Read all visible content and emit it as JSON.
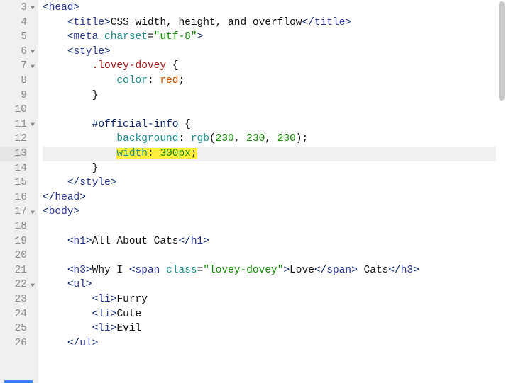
{
  "editor": {
    "first_line": 3,
    "active_line": 13,
    "highlight_line": 13,
    "highlight_text": "width: 300px;",
    "fold_lines": [
      3,
      6,
      7,
      11,
      17,
      22
    ],
    "lines": [
      {
        "n": 3,
        "indent": 0,
        "tokens": [
          {
            "t": "<",
            "c": "tag"
          },
          {
            "t": "head",
            "c": "name"
          },
          {
            "t": ">",
            "c": "tag"
          }
        ]
      },
      {
        "n": 4,
        "indent": 1,
        "tokens": [
          {
            "t": "<",
            "c": "tag"
          },
          {
            "t": "title",
            "c": "name"
          },
          {
            "t": ">",
            "c": "tag"
          },
          {
            "t": "CSS width, height, and overflow",
            "c": "text"
          },
          {
            "t": "</",
            "c": "tag"
          },
          {
            "t": "title",
            "c": "name"
          },
          {
            "t": ">",
            "c": "tag"
          }
        ]
      },
      {
        "n": 5,
        "indent": 1,
        "tokens": [
          {
            "t": "<",
            "c": "tag"
          },
          {
            "t": "meta",
            "c": "name"
          },
          {
            "t": " ",
            "c": "text"
          },
          {
            "t": "charset",
            "c": "attrn"
          },
          {
            "t": "=",
            "c": "punct"
          },
          {
            "t": "\"utf-8\"",
            "c": "val"
          },
          {
            "t": ">",
            "c": "tag"
          }
        ]
      },
      {
        "n": 6,
        "indent": 1,
        "tokens": [
          {
            "t": "<",
            "c": "tag"
          },
          {
            "t": "style",
            "c": "name"
          },
          {
            "t": ">",
            "c": "tag"
          }
        ]
      },
      {
        "n": 7,
        "indent": 2,
        "tokens": [
          {
            "t": ".lovey-dovey",
            "c": "sel"
          },
          {
            "t": " {",
            "c": "punct"
          }
        ]
      },
      {
        "n": 8,
        "indent": 3,
        "tokens": [
          {
            "t": "color",
            "c": "prop"
          },
          {
            "t": ": ",
            "c": "punct"
          },
          {
            "t": "red",
            "c": "kw"
          },
          {
            "t": ";",
            "c": "punct"
          }
        ]
      },
      {
        "n": 9,
        "indent": 2,
        "tokens": [
          {
            "t": "}",
            "c": "punct"
          }
        ]
      },
      {
        "n": 10,
        "indent": 0,
        "tokens": []
      },
      {
        "n": 11,
        "indent": 2,
        "tokens": [
          {
            "t": "#official-info",
            "c": "selid"
          },
          {
            "t": " {",
            "c": "punct"
          }
        ]
      },
      {
        "n": 12,
        "indent": 3,
        "tokens": [
          {
            "t": "background",
            "c": "prop"
          },
          {
            "t": ": ",
            "c": "punct"
          },
          {
            "t": "rgb",
            "c": "func"
          },
          {
            "t": "(",
            "c": "punct"
          },
          {
            "t": "230",
            "c": "num"
          },
          {
            "t": ", ",
            "c": "punct"
          },
          {
            "t": "230",
            "c": "num"
          },
          {
            "t": ", ",
            "c": "punct"
          },
          {
            "t": "230",
            "c": "num"
          },
          {
            "t": ")",
            "c": "punct"
          },
          {
            "t": ";",
            "c": "punct"
          }
        ]
      },
      {
        "n": 13,
        "indent": 3,
        "tokens": [
          {
            "t": "width",
            "c": "prop",
            "hl": true
          },
          {
            "t": ": ",
            "c": "punct",
            "hl": true
          },
          {
            "t": "300px",
            "c": "num",
            "hl": true
          },
          {
            "t": ";",
            "c": "punct",
            "hl": true
          }
        ]
      },
      {
        "n": 14,
        "indent": 2,
        "tokens": [
          {
            "t": "}",
            "c": "punct"
          }
        ]
      },
      {
        "n": 15,
        "indent": 1,
        "tokens": [
          {
            "t": "</",
            "c": "tag"
          },
          {
            "t": "style",
            "c": "name"
          },
          {
            "t": ">",
            "c": "tag"
          }
        ]
      },
      {
        "n": 16,
        "indent": 0,
        "tokens": [
          {
            "t": "</",
            "c": "tag"
          },
          {
            "t": "head",
            "c": "name"
          },
          {
            "t": ">",
            "c": "tag"
          }
        ]
      },
      {
        "n": 17,
        "indent": 0,
        "tokens": [
          {
            "t": "<",
            "c": "tag"
          },
          {
            "t": "body",
            "c": "name"
          },
          {
            "t": ">",
            "c": "tag"
          }
        ]
      },
      {
        "n": 18,
        "indent": 0,
        "tokens": []
      },
      {
        "n": 19,
        "indent": 1,
        "tokens": [
          {
            "t": "<",
            "c": "tag"
          },
          {
            "t": "h1",
            "c": "name"
          },
          {
            "t": ">",
            "c": "tag"
          },
          {
            "t": "All About Cats",
            "c": "text"
          },
          {
            "t": "</",
            "c": "tag"
          },
          {
            "t": "h1",
            "c": "name"
          },
          {
            "t": ">",
            "c": "tag"
          }
        ]
      },
      {
        "n": 20,
        "indent": 0,
        "tokens": []
      },
      {
        "n": 21,
        "indent": 1,
        "tokens": [
          {
            "t": "<",
            "c": "tag"
          },
          {
            "t": "h3",
            "c": "name"
          },
          {
            "t": ">",
            "c": "tag"
          },
          {
            "t": "Why I ",
            "c": "text"
          },
          {
            "t": "<",
            "c": "tag"
          },
          {
            "t": "span",
            "c": "name"
          },
          {
            "t": " ",
            "c": "text"
          },
          {
            "t": "class",
            "c": "attrn"
          },
          {
            "t": "=",
            "c": "punct"
          },
          {
            "t": "\"lovey-dovey\"",
            "c": "val"
          },
          {
            "t": ">",
            "c": "tag"
          },
          {
            "t": "Love",
            "c": "text"
          },
          {
            "t": "</",
            "c": "tag"
          },
          {
            "t": "span",
            "c": "name"
          },
          {
            "t": ">",
            "c": "tag"
          },
          {
            "t": " Cats",
            "c": "text"
          },
          {
            "t": "</",
            "c": "tag"
          },
          {
            "t": "h3",
            "c": "name"
          },
          {
            "t": ">",
            "c": "tag"
          }
        ]
      },
      {
        "n": 22,
        "indent": 1,
        "tokens": [
          {
            "t": "<",
            "c": "tag"
          },
          {
            "t": "ul",
            "c": "name"
          },
          {
            "t": ">",
            "c": "tag"
          }
        ]
      },
      {
        "n": 23,
        "indent": 2,
        "tokens": [
          {
            "t": "<",
            "c": "tag"
          },
          {
            "t": "li",
            "c": "name"
          },
          {
            "t": ">",
            "c": "tag"
          },
          {
            "t": "Furry",
            "c": "text"
          }
        ]
      },
      {
        "n": 24,
        "indent": 2,
        "tokens": [
          {
            "t": "<",
            "c": "tag"
          },
          {
            "t": "li",
            "c": "name"
          },
          {
            "t": ">",
            "c": "tag"
          },
          {
            "t": "Cute",
            "c": "text"
          }
        ]
      },
      {
        "n": 25,
        "indent": 2,
        "tokens": [
          {
            "t": "<",
            "c": "tag"
          },
          {
            "t": "li",
            "c": "name"
          },
          {
            "t": ">",
            "c": "tag"
          },
          {
            "t": "Evil",
            "c": "text"
          }
        ]
      },
      {
        "n": 26,
        "indent": 1,
        "tokens": [
          {
            "t": "</",
            "c": "tag"
          },
          {
            "t": "ul",
            "c": "name"
          },
          {
            "t": ">",
            "c": "tag"
          }
        ]
      }
    ],
    "indent_unit": "    ",
    "colors": {
      "gutter_bg": "#f0f0f0",
      "gutter_fg": "#8a8a8a",
      "active_bg": "#f0f0f0",
      "highlight_bg": "#ffef3d",
      "scrollbar": "#c9c9c9",
      "accent": "#3b82f6"
    }
  }
}
